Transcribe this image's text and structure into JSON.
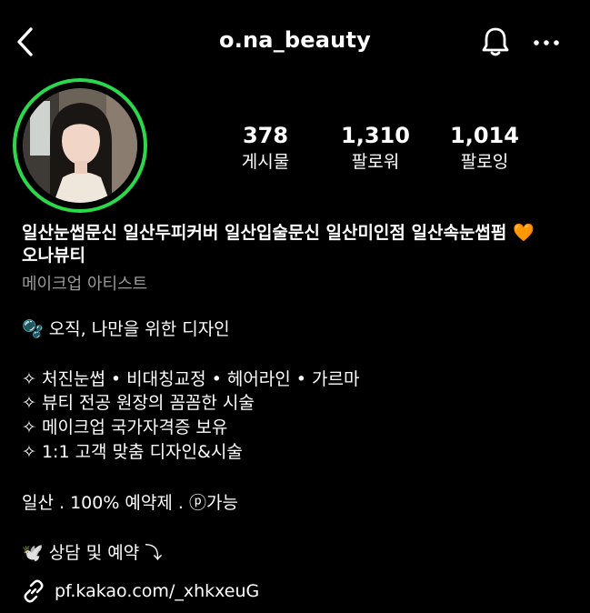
{
  "header": {
    "username": "o.na_beauty",
    "back_icon": "chevron-left-icon",
    "bell_icon": "bell-icon",
    "more_icon": "more-horizontal-icon"
  },
  "stats": [
    {
      "value": "378",
      "label": "게시물"
    },
    {
      "value": "1,310",
      "label": "팔로워"
    },
    {
      "value": "1,014",
      "label": "팔로잉"
    }
  ],
  "bio": {
    "name_line1": "일산눈썹문신 일산두피커버 일산입술문신 일산미인점 일산속눈썹펌 🧡",
    "name_line2": "오나뷰티",
    "category": "메이크업 아티스트",
    "tagline": "🫧 오직, 나만을 위한 디자인",
    "services": [
      "✧ 처진눈썹 • 비대칭교정 • 헤어라인 • 가르마",
      "✧ 뷰티 전공 원장의 꼼꼼한 시술",
      "✧ 메이크업 국가자격증 보유",
      "✧ 1:1 고객 맞춤 디자인&시술"
    ],
    "reservation": "일산 . 100% 예약제 . ⓟ가능",
    "consult": "🕊️ 상담 및 예약 ⤵",
    "link": "pf.kakao.com/_xhkxeuG"
  },
  "colors": {
    "background": "#000000",
    "story_ring": "#2cd84b",
    "category_gray": "#9a9a9a"
  }
}
